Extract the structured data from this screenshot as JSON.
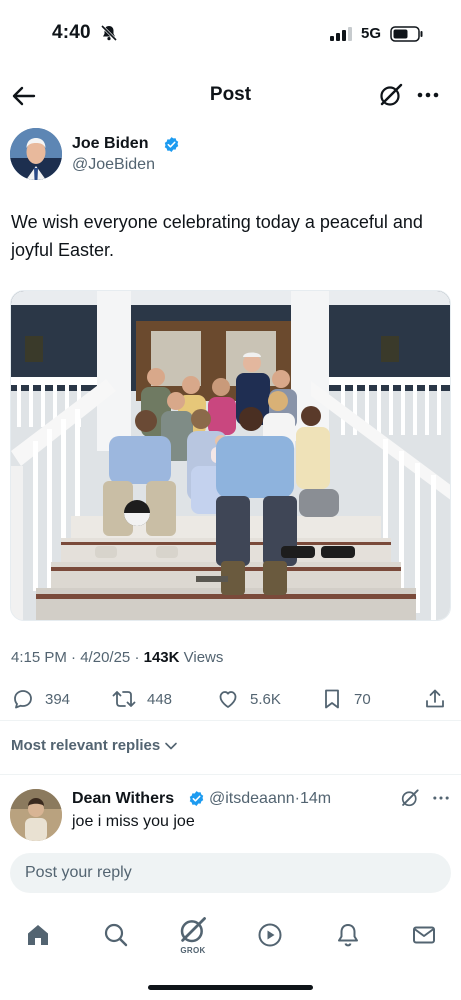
{
  "status_bar": {
    "time": "4:40",
    "network": "5G"
  },
  "header": {
    "title": "Post"
  },
  "post": {
    "author_name": "Joe Biden",
    "author_handle": "@JoeBiden",
    "text": "We wish everyone celebrating today a peaceful and joyful Easter.",
    "time": "4:15 PM",
    "date": "4/20/25",
    "views_count": "143K",
    "views_label": "Views",
    "sep": "·"
  },
  "actions": {
    "replies": "394",
    "reposts": "448",
    "likes": "5.6K",
    "bookmarks": "70"
  },
  "replies_filter": {
    "label": "Most relevant replies"
  },
  "reply": {
    "author_name": "Dean Withers",
    "author_handle": "@itsdeaann",
    "sep": "·",
    "age": "14m",
    "text": "joe i miss you joe"
  },
  "composer": {
    "placeholder": "Post your reply"
  },
  "tabbar": {
    "grok_label": "GROK"
  },
  "colors": {
    "verified": "#1d9bf0",
    "text": "#0f1419",
    "secondary": "#536471"
  }
}
